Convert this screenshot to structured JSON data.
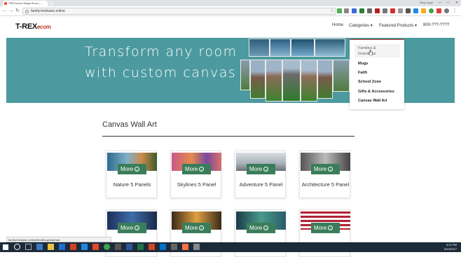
{
  "browser": {
    "tab_title": "TREXecom Mega Store | ...",
    "user_label": "Blog Jeppi",
    "url": "family.trexbasic.online",
    "minimize": "—",
    "maximize": "□",
    "close": "✕",
    "back": "←",
    "forward": "→",
    "reload": "↻",
    "menu": "⋮",
    "bookmark": "☆"
  },
  "site": {
    "logo_main": "T-REX",
    "logo_sub": "ecom",
    "nav": {
      "home": "Home",
      "categories": "Categories",
      "featured": "Featured Products",
      "phone": "800-???-????",
      "caret": "▾"
    },
    "hero": {
      "line1": "Transform any room",
      "line2": "with custom canvas art"
    },
    "dropdown": [
      "Families & Grandmas",
      "Mugs",
      "Faith",
      "School Zone",
      "Gifts & Accessories",
      "Canvas Wall Art"
    ],
    "section_title": "Canvas Wall Art",
    "more_label": "More",
    "more_icon": "⌄",
    "cards": [
      {
        "name": "Nature 5 Panels"
      },
      {
        "name": "Skylines 5 Panel"
      },
      {
        "name": "Adventure 5 Panel"
      },
      {
        "name": "Architecture 5 Panel"
      },
      {
        "name": ""
      },
      {
        "name": ""
      },
      {
        "name": ""
      },
      {
        "name": ""
      }
    ]
  },
  "status_url": "family.trexbasic.online/families-grandmas/",
  "taskbar": {
    "time": "5:12 PM",
    "date": "8/24/2017"
  },
  "colors": {
    "hero_teal": "#4c9aa0",
    "more_green": "#3a7d5a",
    "accent_red": "#c0392b"
  }
}
